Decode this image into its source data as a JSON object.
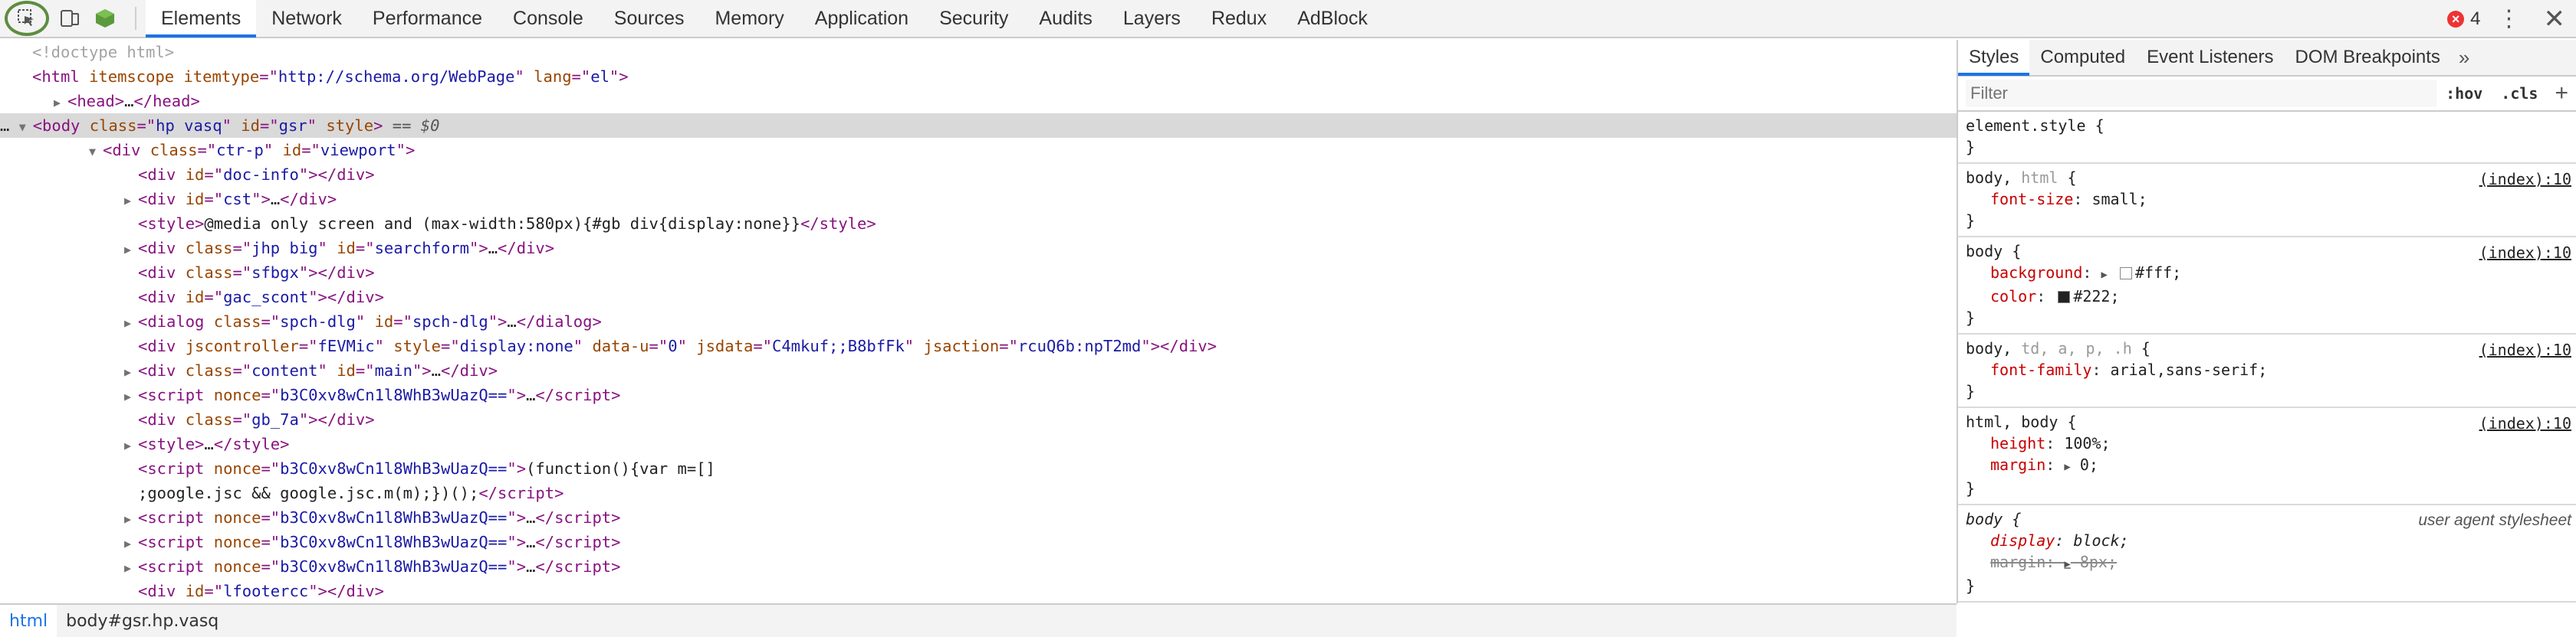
{
  "toolbar": {
    "tabs": [
      "Elements",
      "Network",
      "Performance",
      "Console",
      "Sources",
      "Memory",
      "Application",
      "Security",
      "Audits",
      "Layers",
      "Redux",
      "AdBlock"
    ],
    "error_count": "4"
  },
  "dom": {
    "lines": [
      {
        "indent": 0,
        "tri": "",
        "html": "<span class='cm'>&lt;!doctype html&gt;</span>"
      },
      {
        "indent": 0,
        "tri": "",
        "html": "<span class='tag'>&lt;html </span><span class='an'>itemscope itemtype</span><span class='tag'>=\"</span><span class='av'>http://schema.org/WebPage</span><span class='tag'>\" </span><span class='an'>lang</span><span class='tag'>=\"</span><span class='av'>el</span><span class='tag'>\"&gt;</span>"
      },
      {
        "indent": 1,
        "tri": "▶",
        "html": "<span class='tag'>&lt;head&gt;</span><span class='tx'>…</span><span class='tag'>&lt;/head&gt;</span>"
      },
      {
        "indent": 0,
        "tri": "▼",
        "sel": true,
        "html": "<span class='tx'>… </span><span class='tag'>&lt;body </span><span class='an'>class</span><span class='tag'>=\"</span><span class='av'>hp vasq</span><span class='tag'>\" </span><span class='an'>id</span><span class='tag'>=\"</span><span class='av'>gsr</span><span class='tag'>\" </span><span class='an'>style</span><span class='tag'>&gt;</span><span class='eq'> == $0</span>"
      },
      {
        "indent": 2,
        "tri": "▼",
        "html": "<span class='tag'>&lt;div </span><span class='an'>class</span><span class='tag'>=\"</span><span class='av'>ctr-p</span><span class='tag'>\" </span><span class='an'>id</span><span class='tag'>=\"</span><span class='av'>viewport</span><span class='tag'>\"&gt;</span>"
      },
      {
        "indent": 3,
        "tri": "",
        "html": "<span class='tag'>&lt;div </span><span class='an'>id</span><span class='tag'>=\"</span><span class='av'>doc-info</span><span class='tag'>\"&gt;&lt;/div&gt;</span>"
      },
      {
        "indent": 3,
        "tri": "▶",
        "html": "<span class='tag'>&lt;div </span><span class='an'>id</span><span class='tag'>=\"</span><span class='av'>cst</span><span class='tag'>\"&gt;</span><span class='tx'>…</span><span class='tag'>&lt;/div&gt;</span>"
      },
      {
        "indent": 3,
        "tri": "",
        "html": "<span class='tag'>&lt;style&gt;</span><span class='tx'>@media only screen and (max-width:580px){#gb div{display:none}}</span><span class='tag'>&lt;/style&gt;</span>"
      },
      {
        "indent": 3,
        "tri": "▶",
        "html": "<span class='tag'>&lt;div </span><span class='an'>class</span><span class='tag'>=\"</span><span class='av'>jhp big</span><span class='tag'>\" </span><span class='an'>id</span><span class='tag'>=\"</span><span class='av'>searchform</span><span class='tag'>\"&gt;</span><span class='tx'>…</span><span class='tag'>&lt;/div&gt;</span>"
      },
      {
        "indent": 3,
        "tri": "",
        "html": "<span class='tag'>&lt;div </span><span class='an'>class</span><span class='tag'>=\"</span><span class='av'>sfbgx</span><span class='tag'>\"&gt;&lt;/div&gt;</span>"
      },
      {
        "indent": 3,
        "tri": "",
        "html": "<span class='tag'>&lt;div </span><span class='an'>id</span><span class='tag'>=\"</span><span class='av'>gac_scont</span><span class='tag'>\"&gt;&lt;/div&gt;</span>"
      },
      {
        "indent": 3,
        "tri": "▶",
        "html": "<span class='tag'>&lt;dialog </span><span class='an'>class</span><span class='tag'>=\"</span><span class='av'>spch-dlg</span><span class='tag'>\" </span><span class='an'>id</span><span class='tag'>=\"</span><span class='av'>spch-dlg</span><span class='tag'>\"&gt;</span><span class='tx'>…</span><span class='tag'>&lt;/dialog&gt;</span>"
      },
      {
        "indent": 3,
        "tri": "",
        "html": "<span class='tag'>&lt;div </span><span class='an'>jscontroller</span><span class='tag'>=\"</span><span class='av'>fEVMic</span><span class='tag'>\" </span><span class='an'>style</span><span class='tag'>=\"</span><span class='av'>display:none</span><span class='tag'>\" </span><span class='an'>data-u</span><span class='tag'>=\"</span><span class='av'>0</span><span class='tag'>\" </span><span class='an'>jsdata</span><span class='tag'>=\"</span><span class='av'>C4mkuf;;B8bfFk</span><span class='tag'>\" </span><span class='an'>jsaction</span><span class='tag'>=\"</span><span class='av'>rcuQ6b:npT2md</span><span class='tag'>\"&gt;&lt;/div&gt;</span>"
      },
      {
        "indent": 3,
        "tri": "▶",
        "html": "<span class='tag'>&lt;div </span><span class='an'>class</span><span class='tag'>=\"</span><span class='av'>content</span><span class='tag'>\" </span><span class='an'>id</span><span class='tag'>=\"</span><span class='av'>main</span><span class='tag'>\"&gt;</span><span class='tx'>…</span><span class='tag'>&lt;/div&gt;</span>"
      },
      {
        "indent": 3,
        "tri": "▶",
        "html": "<span class='tag'>&lt;script </span><span class='an'>nonce</span><span class='tag'>=\"</span><span class='av'>b3C0xv8wCn1l8WhB3wUazQ==</span><span class='tag'>\"&gt;</span><span class='tx'>…</span><span class='tag'>&lt;/script&gt;</span>"
      },
      {
        "indent": 3,
        "tri": "",
        "html": "<span class='tag'>&lt;div </span><span class='an'>class</span><span class='tag'>=\"</span><span class='av'>gb_7a</span><span class='tag'>\"&gt;&lt;/div&gt;</span>"
      },
      {
        "indent": 3,
        "tri": "▶",
        "html": "<span class='tag'>&lt;style&gt;</span><span class='tx'>…</span><span class='tag'>&lt;/style&gt;</span>"
      },
      {
        "indent": 3,
        "tri": "",
        "html": "<span class='tag'>&lt;script </span><span class='an'>nonce</span><span class='tag'>=\"</span><span class='av'>b3C0xv8wCn1l8WhB3wUazQ==</span><span class='tag'>\"&gt;</span><span class='tx'>(function(){var m=[]</span>"
      },
      {
        "indent": 3,
        "tri": "",
        "html": "<span class='tx'>;google.jsc &amp;&amp; google.jsc.m(m);})();</span><span class='tag'>&lt;/script&gt;</span>"
      },
      {
        "indent": 3,
        "tri": "▶",
        "html": "<span class='tag'>&lt;script </span><span class='an'>nonce</span><span class='tag'>=\"</span><span class='av'>b3C0xv8wCn1l8WhB3wUazQ==</span><span class='tag'>\"&gt;</span><span class='tx'>…</span><span class='tag'>&lt;/script&gt;</span>"
      },
      {
        "indent": 3,
        "tri": "▶",
        "html": "<span class='tag'>&lt;script </span><span class='an'>nonce</span><span class='tag'>=\"</span><span class='av'>b3C0xv8wCn1l8WhB3wUazQ==</span><span class='tag'>\"&gt;</span><span class='tx'>…</span><span class='tag'>&lt;/script&gt;</span>"
      },
      {
        "indent": 3,
        "tri": "▶",
        "html": "<span class='tag'>&lt;script </span><span class='an'>nonce</span><span class='tag'>=\"</span><span class='av'>b3C0xv8wCn1l8WhB3wUazQ==</span><span class='tag'>\"&gt;</span><span class='tx'>…</span><span class='tag'>&lt;/script&gt;</span>"
      },
      {
        "indent": 3,
        "tri": "",
        "html": "<span class='tag'>&lt;div </span><span class='an'>id</span><span class='tag'>=\"</span><span class='av'>lfootercc</span><span class='tag'>\"&gt;&lt;/div&gt;</span>"
      }
    ]
  },
  "breadcrumb": [
    "html",
    "body#gsr.hp.vasq"
  ],
  "styles": {
    "tabs": [
      "Styles",
      "Computed",
      "Event Listeners",
      "DOM Breakpoints"
    ],
    "more": "»",
    "filter_placeholder": "Filter",
    "hov": ":hov",
    "cls": ".cls",
    "plus": "+",
    "rules": [
      {
        "selector_html": "element.style {",
        "source": "",
        "decls": []
      },
      {
        "selector_html": "body, <span class='dim'>html</span> {",
        "source": "(index):10",
        "decls": [
          {
            "name": "font-size",
            "value": "small;"
          }
        ]
      },
      {
        "selector_html": "body {",
        "source": "(index):10",
        "decls": [
          {
            "name": "background",
            "value": "#fff;",
            "swatch": "#ffffff",
            "arrow": true
          },
          {
            "name": "color",
            "value": "#222;",
            "swatch": "#222222"
          }
        ]
      },
      {
        "selector_html": "body, <span class='dim'>td, a, p, .h</span> {",
        "source": "(index):10",
        "decls": [
          {
            "name": "font-family",
            "value": "arial,sans-serif;"
          }
        ]
      },
      {
        "selector_html": "html, body {",
        "source": "(index):10",
        "decls": [
          {
            "name": "height",
            "value": "100%;"
          },
          {
            "name": "margin",
            "value": "0;",
            "arrow": true
          }
        ]
      },
      {
        "selector_html": "<span class='ital'>body {</span>",
        "source": "user agent stylesheet",
        "ua": true,
        "decls": [
          {
            "name": "display",
            "value": "block;",
            "ital": true
          },
          {
            "name": "margin",
            "value": "8px;",
            "strike": true,
            "arrow": true
          }
        ]
      }
    ]
  }
}
